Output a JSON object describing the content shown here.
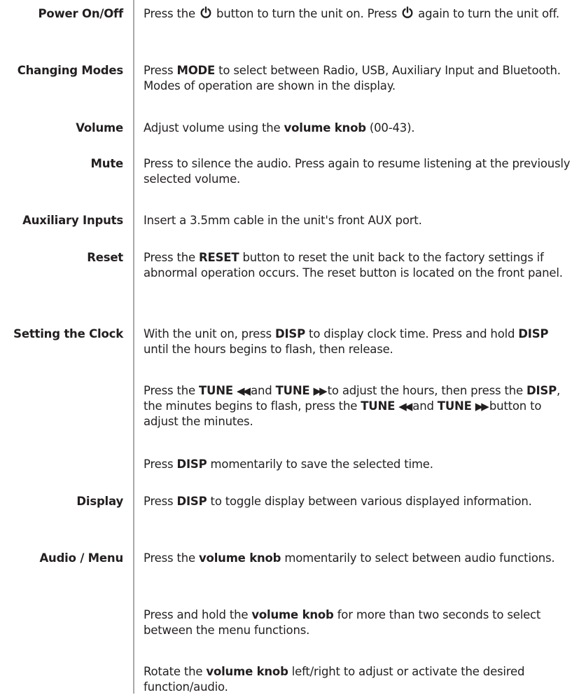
{
  "rows": {
    "power": {
      "term": "Power On/Off",
      "d1": "Press the",
      "d2": "button to turn the unit on. Press",
      "d3": "again to turn the unit off."
    },
    "modes": {
      "term": "Changing Modes",
      "d1": "Press",
      "b1": "MODE",
      "d2": "to select between Radio, USB, Auxiliary Input and Bluetooth. Modes of operation are shown in the display."
    },
    "volume": {
      "term": "Volume",
      "d1": "Adjust volume using the",
      "b1": "volume knob",
      "d2": "(00-43)."
    },
    "mute": {
      "term": "Mute",
      "d1": "Press to silence the audio. Press again to resume listening at the previously selected volume."
    },
    "aux": {
      "term": "Auxiliary Inputs",
      "d1": "Insert a 3.5mm cable in the unit's front AUX port."
    },
    "reset": {
      "term": "Reset",
      "d1": "Press the",
      "b1": "RESET",
      "d2": "button to reset the unit back to the factory settings if abnormal operation occurs. The reset button is located on the front panel."
    },
    "clock": {
      "term": "Setting the Clock",
      "p1": {
        "d1": "With the unit on, press",
        "b1": "DISP",
        "d2": "to display clock time. Press and hold",
        "b2": "DISP",
        "d3": "until the hours begins to flash, then release."
      },
      "p2": {
        "d1": "Press the",
        "b1": "TUNE",
        "s1": "◀◀",
        "d2": "and",
        "b2": "TUNE",
        "s2": "▶▶",
        "d3": "to adjust the hours, then press the",
        "b3": "DISP",
        "d4": ", the minutes begins to flash, press the",
        "b4": "TUNE",
        "s3": "◀◀",
        "d5": "and",
        "b5": "TUNE",
        "s4": "▶▶",
        "d6": "button to adjust the minutes."
      },
      "p3": {
        "d1": "Press",
        "b1": "DISP",
        "d2": "momentarily to save the selected time."
      }
    },
    "display": {
      "term": "Display",
      "d1": "Press",
      "b1": "DISP",
      "d2": "to toggle display between various displayed information."
    },
    "audio": {
      "term": "Audio / Menu",
      "p1": {
        "d1": "Press the",
        "b1": "volume knob",
        "d2": "momentarily to select between audio functions."
      },
      "p2": {
        "d1": "Press and hold the",
        "b1": "volume knob",
        "d2": "for more than two seconds to select between the menu functions."
      },
      "p3": {
        "d1": "Rotate the",
        "b1": "volume knob",
        "d2": "left/right to adjust or activate the desired function/audio."
      }
    }
  }
}
